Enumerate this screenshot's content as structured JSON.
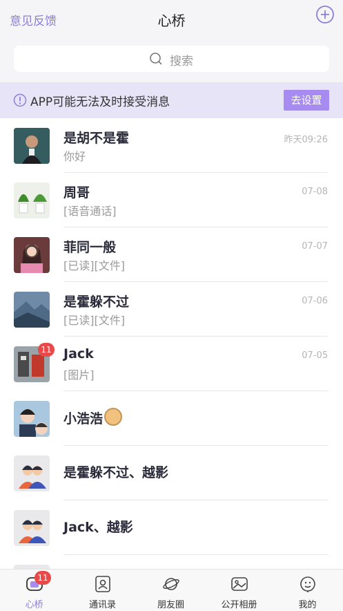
{
  "header": {
    "feedback_label": "意见反馈",
    "title": "心桥",
    "add_icon": "plus-circle-icon"
  },
  "search": {
    "placeholder": "搜索",
    "icon": "search-icon"
  },
  "notice": {
    "text": "APP可能无法及时接受消息",
    "button_label": "去设置",
    "icon": "alert-circle-icon"
  },
  "chats": [
    {
      "name": "是胡不是霍",
      "message": "你好",
      "time": "昨天09:26",
      "badge": ""
    },
    {
      "name": "周哥",
      "message": "[语音通话]",
      "time": "07-08",
      "badge": ""
    },
    {
      "name": "菲同一般",
      "message": "[已读][文件]",
      "time": "07-07",
      "badge": ""
    },
    {
      "name": "是霍躲不过",
      "message": "[已读][文件]",
      "time": "07-06",
      "badge": ""
    },
    {
      "name": "Jack",
      "message": "[图片]",
      "time": "07-05",
      "badge": "11"
    },
    {
      "name": "小浩浩",
      "message": "",
      "time": "",
      "badge": ""
    },
    {
      "name": "是霍躲不过、越影",
      "message": "",
      "time": "",
      "badge": ""
    },
    {
      "name": "Jack、越影",
      "message": "",
      "time": "",
      "badge": ""
    }
  ],
  "tabbar": {
    "tabs": [
      {
        "label": "心桥",
        "icon": "chat-bubble-icon",
        "badge": "11"
      },
      {
        "label": "通讯录",
        "icon": "contacts-icon"
      },
      {
        "label": "朋友圈",
        "icon": "planet-icon"
      },
      {
        "label": "公开相册",
        "icon": "image-icon"
      },
      {
        "label": "我的",
        "icon": "profile-icon"
      }
    ]
  },
  "colors": {
    "accent": "#8c7fd6",
    "button": "#a78bf0",
    "badge": "#e84a4a"
  }
}
